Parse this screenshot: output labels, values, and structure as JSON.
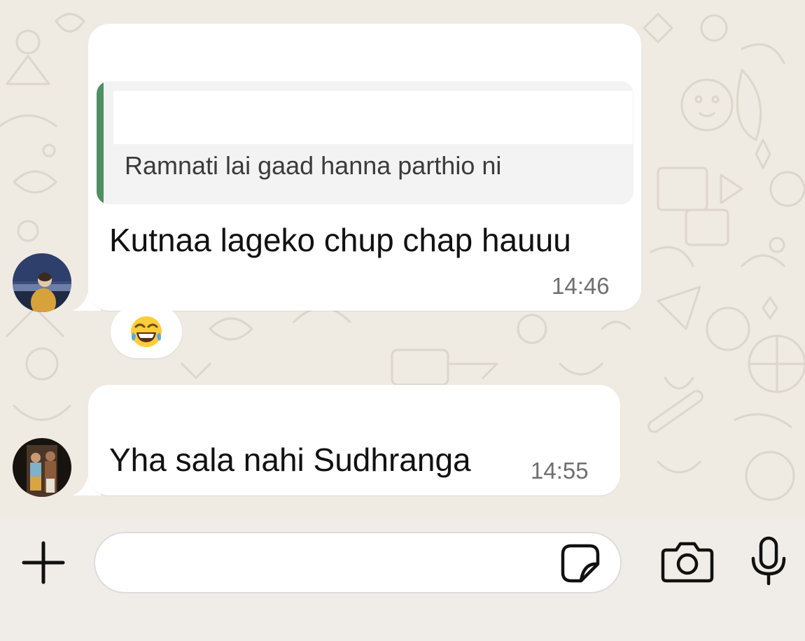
{
  "chat": {
    "messages": [
      {
        "quoted_text": "Ramnati lai gaad hanna parthio ni",
        "text": "Kutnaa lageko chup chap hauuu",
        "time": "14:46",
        "reaction": "😂"
      },
      {
        "text": "Yha sala nahi Sudhranga",
        "time": "14:55"
      }
    ]
  },
  "composer": {
    "placeholder": "",
    "icons": [
      "plus-icon",
      "sticker-icon",
      "camera-icon",
      "mic-icon"
    ]
  },
  "colors": {
    "background": "#efeae2",
    "bubble": "#ffffff",
    "quote_bar": "#4f8f62",
    "time_text": "#6f6f6f"
  }
}
